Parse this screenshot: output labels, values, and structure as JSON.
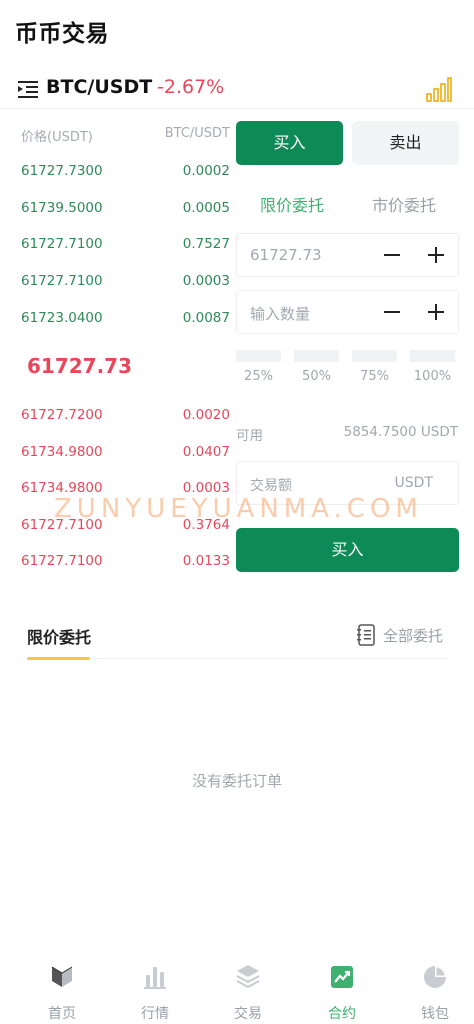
{
  "page_title": "币币交易",
  "pair": {
    "name": "BTC/USDT",
    "change": "-2.67%"
  },
  "orderbook": {
    "price_header": "价格(USDT)",
    "amount_header": "BTC/USDT",
    "buys": [
      {
        "price": "61727.7300",
        "amount": "0.0002"
      },
      {
        "price": "61739.5000",
        "amount": "0.0005"
      },
      {
        "price": "61727.7100",
        "amount": "0.7527"
      },
      {
        "price": "61727.7100",
        "amount": "0.0003"
      },
      {
        "price": "61723.0400",
        "amount": "0.0087"
      }
    ],
    "last_price": "61727.73",
    "sells": [
      {
        "price": "61727.7200",
        "amount": "0.0020"
      },
      {
        "price": "61734.9800",
        "amount": "0.0407"
      },
      {
        "price": "61734.9800",
        "amount": "0.0003"
      },
      {
        "price": "61727.7100",
        "amount": "0.3764"
      },
      {
        "price": "61727.7100",
        "amount": "0.0133"
      }
    ]
  },
  "trade": {
    "buy_tab": "买入",
    "sell_tab": "卖出",
    "limit_label": "限价委托",
    "market_label": "市价委托",
    "price_value": "61727.73",
    "quantity_placeholder": "输入数量",
    "percent_options": [
      "25%",
      "50%",
      "75%",
      "100%"
    ],
    "available_label": "可用",
    "available_value": "5854.7500 USDT",
    "amount_label": "交易额",
    "amount_unit": "USDT",
    "submit_label": "买入"
  },
  "watermark": "ZUNYUEYUANMA.COM",
  "orders": {
    "tab_label": "限价委托",
    "all_label": "全部委托",
    "empty_text": "没有委托订单"
  },
  "nav": [
    {
      "label": "首页",
      "icon": "home-icon"
    },
    {
      "label": "行情",
      "icon": "market-icon"
    },
    {
      "label": "交易",
      "icon": "trade-icon"
    },
    {
      "label": "合约",
      "icon": "contract-icon"
    },
    {
      "label": "钱包",
      "icon": "wallet-icon"
    }
  ],
  "colors": {
    "accent_green": "#0d8a55",
    "buy_text": "#2e8a58",
    "sell_text": "#e8475a",
    "active_nav": "#40b071",
    "tab_underline": "#f5c842"
  }
}
